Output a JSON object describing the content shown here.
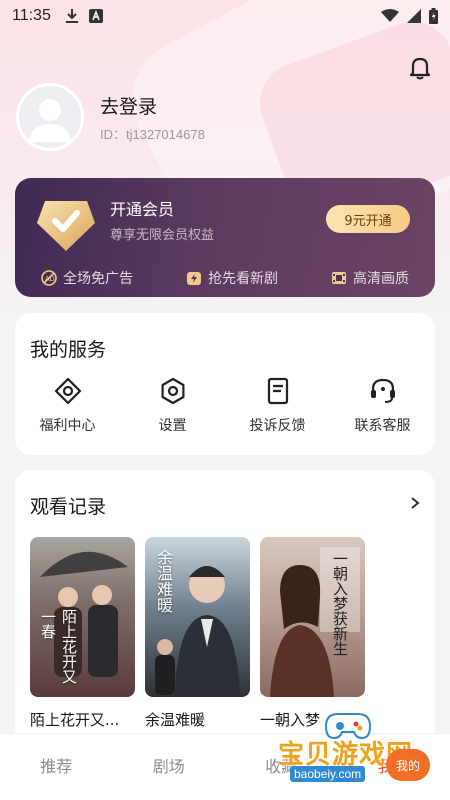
{
  "status_bar": {
    "time": "11:35"
  },
  "profile": {
    "login_label": "去登录",
    "user_id": "ID：tj1327014678"
  },
  "vip": {
    "title": "开通会员",
    "subtitle": "尊享无限会员权益",
    "button": "9元开通",
    "perks": [
      "全场免广告",
      "抢先看新剧",
      "高清画质"
    ]
  },
  "services": {
    "title": "我的服务",
    "items": [
      "福利中心",
      "设置",
      "投诉反馈",
      "联系客服"
    ]
  },
  "history": {
    "title": "观看记录",
    "items": [
      {
        "title": "陌上花开又...",
        "poster_text": "陌上花开又一春"
      },
      {
        "title": "余温难暖",
        "poster_text": "余温难暖"
      },
      {
        "title": "一朝入梦",
        "poster_text": "一朝入梦获新生"
      }
    ]
  },
  "tabs": [
    "推荐",
    "剧场",
    "收藏",
    "我的"
  ],
  "watermark": {
    "text": "宝贝游戏网",
    "url": "baobeiy.com",
    "badge": "我的"
  },
  "colors": {
    "accent": "#e8432f",
    "vip_bg": "#4a3258",
    "vip_button": "#f6cc85"
  }
}
